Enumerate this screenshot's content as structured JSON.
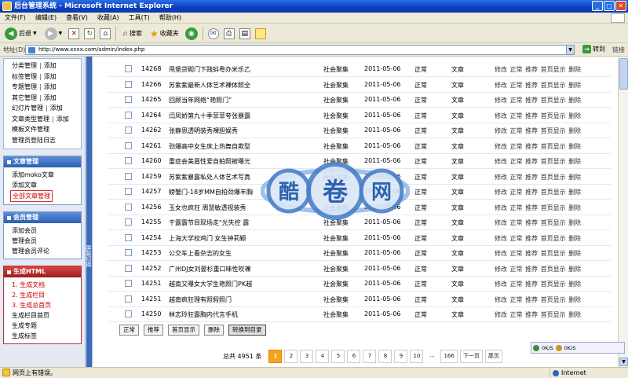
{
  "window": {
    "title": "后台管理系统 - Microsoft Internet Explorer"
  },
  "menu": [
    "文件(F)",
    "编辑(E)",
    "查看(V)",
    "收藏(A)",
    "工具(T)",
    "帮助(H)"
  ],
  "toolbar": {
    "back": "后退",
    "search": "搜索",
    "favorites": "收藏夹"
  },
  "address": {
    "label": "地址(D)",
    "url": "http://www.xxxx.com/admin/index.php",
    "go": "转到",
    "links": "链接"
  },
  "sidebar": {
    "top_items": [
      {
        "label": "分类管理",
        "add": "添加"
      },
      {
        "label": "标签管理",
        "add": "添加"
      },
      {
        "label": "专题管理",
        "add": "添加"
      },
      {
        "label": "其它管理",
        "add": "添加"
      },
      {
        "label": "幻灯片管理",
        "add": "添加"
      },
      {
        "label": "文章类型管理",
        "add": "添加"
      },
      {
        "label": "模板文件管理",
        "add": ""
      },
      {
        "label": "管理员登陆日志",
        "add": ""
      }
    ],
    "article_panel": {
      "title": "文章管理",
      "items": [
        "添加moko文章",
        "添加文章",
        "全部文章管理"
      ]
    },
    "member_panel": {
      "title": "会员管理",
      "items": [
        "添加会员",
        "管理会员",
        "管理会员评论"
      ]
    },
    "html_panel": {
      "title": "生成HTML",
      "items": [
        "1. 生成文档",
        "2. 生成栏目",
        "3. 生成总首页",
        "生成栏目首页",
        "生成专题",
        "生成标签"
      ]
    }
  },
  "splitter_label": "屏幕切换",
  "table": {
    "rows": [
      {
        "id": "14268",
        "title": "甩堡贷砌门下践蚪粤办米乐乙",
        "category": "社会聚集",
        "date": "2011-05-06",
        "status": "正常",
        "type": "文章"
      },
      {
        "id": "14266",
        "title": "苏紫紫最新人体艺术裸体照全",
        "category": "社会聚集",
        "date": "2011-05-06",
        "status": "正常",
        "type": "文章"
      },
      {
        "id": "14265",
        "title": "回顾当年网络“艳照门”",
        "category": "社会聚集",
        "date": "2011-05-06",
        "status": "正常",
        "type": "文章"
      },
      {
        "id": "14264",
        "title": "闫凤娇第九十季菲菲夸张暴露",
        "category": "社会聚集",
        "date": "2011-05-06",
        "status": "正常",
        "type": "文章"
      },
      {
        "id": "14262",
        "title": "张静思透明装秀裸胆娱秀",
        "category": "社会聚集",
        "date": "2011-05-06",
        "status": "正常",
        "type": "文章"
      },
      {
        "id": "14261",
        "title": "劲爆高中女生床上热舞自欺型",
        "category": "社会聚集",
        "date": "2011-05-06",
        "status": "正常",
        "type": "文章"
      },
      {
        "id": "14260",
        "title": "重症会美眉性爱自拍照被曝光",
        "category": "社会聚集",
        "date": "2011-05-06",
        "status": "正常",
        "type": "文章"
      },
      {
        "id": "14259",
        "title": "苏紫紫暴露私处人体艺术写真",
        "category": "社会聚集",
        "date": "2011-05-06",
        "status": "正常",
        "type": "文章"
      },
      {
        "id": "14257",
        "title": "螃蟹门-18岁MM自拍劲爆丰胸",
        "category": "社会聚集",
        "date": "2011-05-06",
        "status": "正常",
        "type": "文章"
      },
      {
        "id": "14256",
        "title": "玉女也疯狂 周慧敏透视装秀",
        "category": "社会聚集",
        "date": "2011-05-06",
        "status": "正常",
        "type": "文章"
      },
      {
        "id": "14255",
        "title": "干露露节目现场走\"光失控 露",
        "category": "社会聚集",
        "date": "2011-05-06",
        "status": "正常",
        "type": "文章"
      },
      {
        "id": "14254",
        "title": "上海大学校鸡门 女生钟莉颖",
        "category": "社会聚集",
        "date": "2011-05-06",
        "status": "正常",
        "type": "文章"
      },
      {
        "id": "14253",
        "title": "公交车上看杂志的女生",
        "category": "社会聚集",
        "date": "2011-05-06",
        "status": "正常",
        "type": "文章"
      },
      {
        "id": "14252",
        "title": "广州DJ女刘晏杉重口味性吹裸",
        "category": "社会聚集",
        "date": "2011-05-06",
        "status": "正常",
        "type": "文章"
      },
      {
        "id": "14251",
        "title": "越南又曝女大学生艳照门PK越",
        "category": "社会聚集",
        "date": "2011-05-06",
        "status": "正常",
        "type": "文章"
      },
      {
        "id": "14251",
        "title": "越南疯狂理有照假照门",
        "category": "社会聚集",
        "date": "2011-05-06",
        "status": "正常",
        "type": "文章"
      },
      {
        "id": "14250",
        "title": "林志玲狂露胸内代言手机",
        "category": "社会聚集",
        "date": "2011-05-06",
        "status": "正常",
        "type": "文章"
      }
    ],
    "actions": "修改 正常 推荐 首页显示 删除"
  },
  "bulk_buttons": [
    "正常",
    "推荐",
    "首页显示",
    "删除",
    "转换到目录"
  ],
  "pagination": {
    "total": "总共 4951 条",
    "pages": [
      "1",
      "2",
      "3",
      "4",
      "5",
      "6",
      "7",
      "8",
      "9",
      "10",
      "...",
      "166"
    ],
    "next": "下一页",
    "last": "尾页",
    "current": "1"
  },
  "speed": {
    "up": "0K/S",
    "down": "0K/S"
  },
  "watermark": {
    "text": "酷 卷 网"
  },
  "status": {
    "message": "网页上有错误。",
    "zone": "Internet"
  }
}
